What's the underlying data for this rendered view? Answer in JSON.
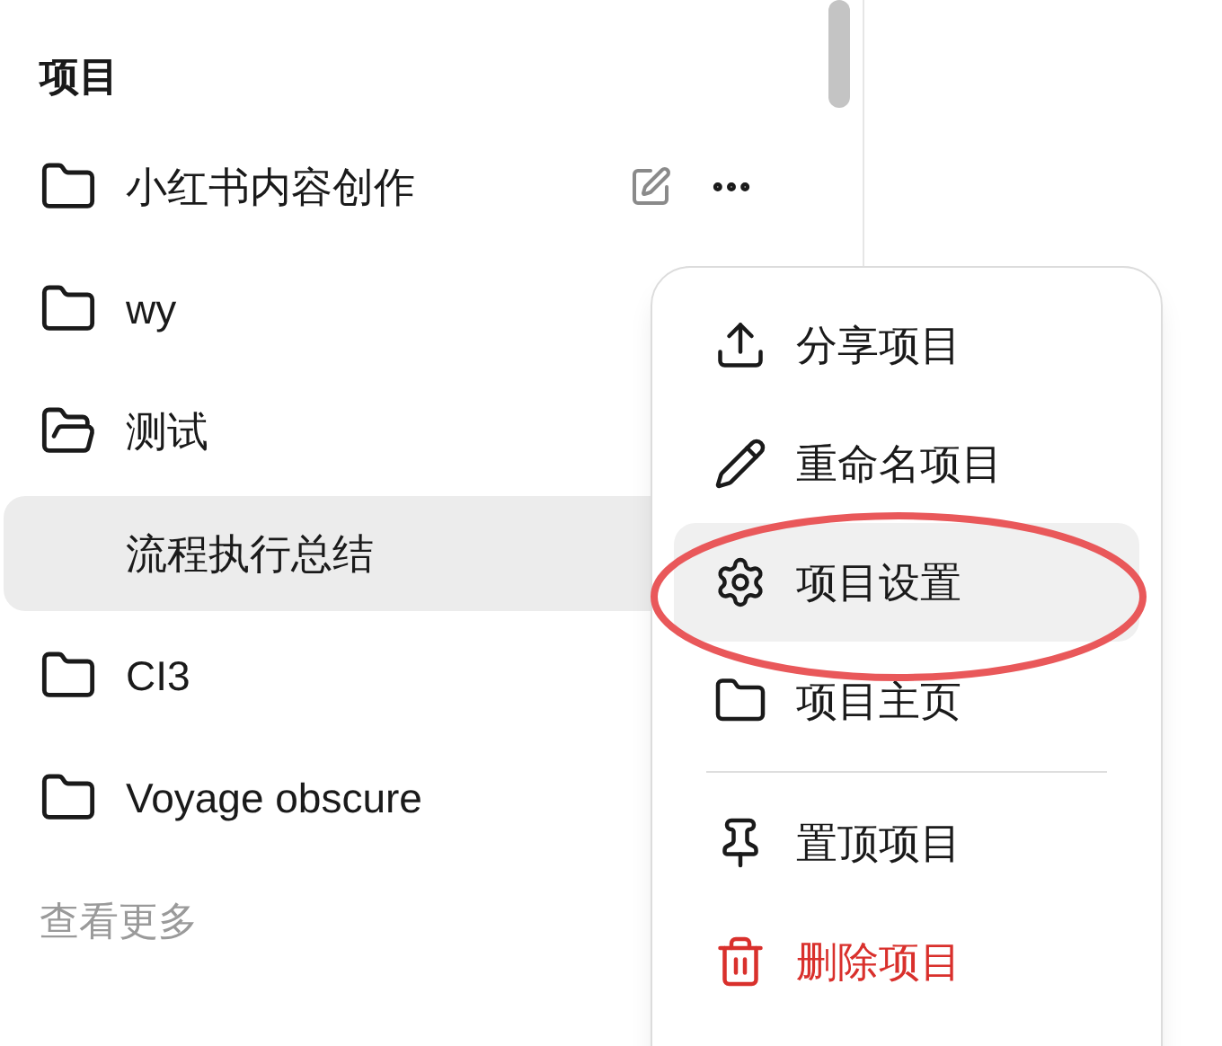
{
  "section_title": "项目",
  "projects": [
    {
      "name": "小红书内容创作",
      "selected": false,
      "expanded": false,
      "show_actions": true
    },
    {
      "name": "wy",
      "selected": false,
      "expanded": false,
      "show_actions": false
    },
    {
      "name": "测试",
      "selected": false,
      "expanded": true,
      "show_actions": false,
      "children": [
        {
          "name": "流程执行总结",
          "selected": true
        }
      ]
    },
    {
      "name": "CI3",
      "selected": false,
      "expanded": false,
      "show_actions": false
    },
    {
      "name": "Voyage obscure",
      "selected": false,
      "expanded": false,
      "show_actions": false
    }
  ],
  "more_link": "查看更多",
  "context_menu": {
    "items": [
      {
        "kind": "item",
        "label": "分享项目",
        "highlighted": false,
        "circled": false
      },
      {
        "kind": "item",
        "label": "重命名项目",
        "highlighted": false,
        "circled": false
      },
      {
        "kind": "item",
        "label": "项目设置",
        "highlighted": true,
        "circled": true
      },
      {
        "kind": "item",
        "label": "项目主页",
        "highlighted": false,
        "circled": false
      },
      {
        "kind": "divider"
      },
      {
        "kind": "item",
        "label": "置顶项目",
        "highlighted": false,
        "circled": false
      },
      {
        "kind": "danger",
        "label": "删除项目",
        "highlighted": false,
        "circled": false
      }
    ]
  }
}
